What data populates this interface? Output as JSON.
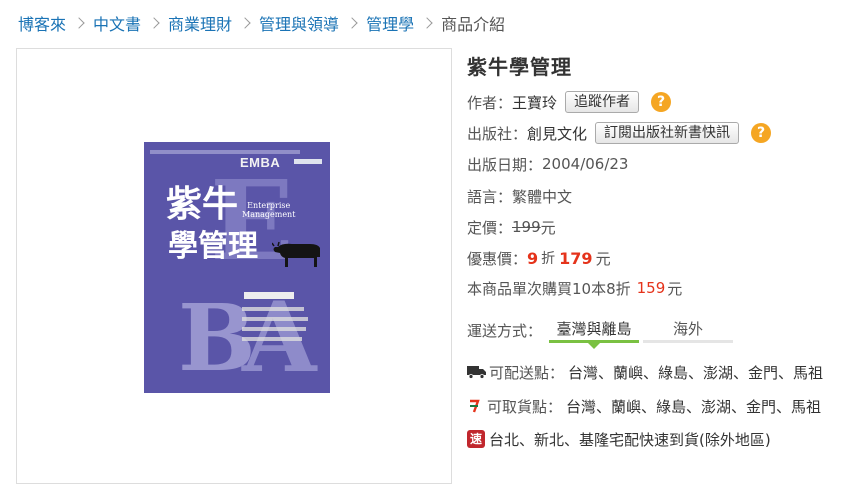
{
  "breadcrumb": {
    "items": [
      "博客來",
      "中文書",
      "商業理財",
      "管理與領導",
      "管理學"
    ],
    "current": "商品介紹"
  },
  "book": {
    "title": "紫牛學管理",
    "cover": {
      "title_line1": "紫牛",
      "title_line2": "學管理",
      "english_line1": "Enterprise",
      "english_line2": "Management",
      "badge": "EMBA",
      "letters": [
        "E",
        "B",
        "A"
      ]
    },
    "author_label": "作者：",
    "author": "王寶玲",
    "follow_author_button": "追蹤作者",
    "publisher_label": "出版社：",
    "publisher": "創見文化",
    "subscribe_publisher_button": "訂閱出版社新書快訊",
    "help_icon_text": "?",
    "pub_date_label": "出版日期：",
    "pub_date": "2004/06/23",
    "language_label": "語言：",
    "language": "繁體中文",
    "list_price_label": "定價：",
    "list_price": "199",
    "currency": "元",
    "sale_label": "優惠價：",
    "discount": "9",
    "discount_unit": "折",
    "sale_price": "179",
    "bulk_text": "本商品單次購買10本8折",
    "bulk_price": "159"
  },
  "shipping": {
    "label": "運送方式：",
    "tabs": [
      "臺灣與離島",
      "海外"
    ],
    "active_tab": 0,
    "delivery_label": "可配送點：",
    "delivery_places": "台灣、蘭嶼、綠島、澎湖、金門、馬祖",
    "pickup_label": "可取貨點：",
    "pickup_places": "台灣、蘭嶼、綠島、澎湖、金門、馬祖",
    "express_badge": "速",
    "express_text": "台北、新北、基隆宅配快速到貨(除外地區)"
  },
  "colors": {
    "link": "#1a73b5",
    "price_red": "#e5331b",
    "help_orange": "#f5a623",
    "tab_green": "#7ac142",
    "cover_purple": "#5a55a8",
    "express_red": "#c1272d"
  }
}
